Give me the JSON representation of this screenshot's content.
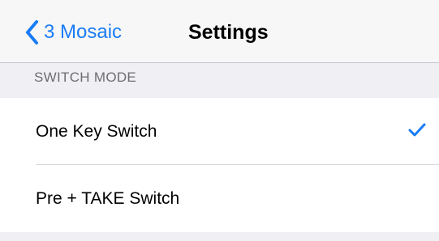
{
  "nav": {
    "back_label": "3 Mosaic",
    "title": "Settings"
  },
  "section": {
    "header": "SWITCH MODE"
  },
  "options": [
    {
      "label": "One Key Switch",
      "selected": true
    },
    {
      "label": "Pre + TAKE Switch",
      "selected": false
    }
  ],
  "icons": {
    "back": "chevron-left-icon",
    "selected": "checkmark-icon"
  },
  "colors": {
    "accent": "#1a7cf5",
    "background": "#efeff4",
    "header_text": "#6d6d72"
  }
}
